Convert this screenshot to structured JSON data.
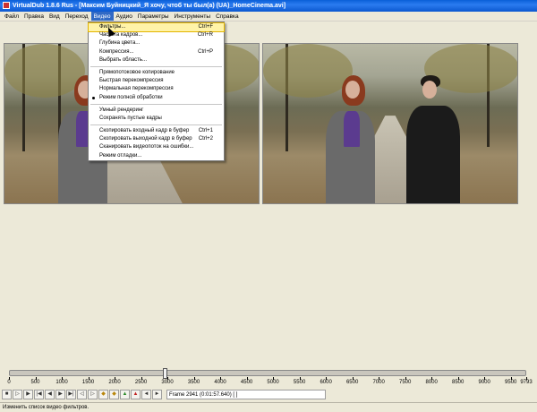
{
  "window": {
    "title": "VirtualDub 1.8.6 Rus - [Максим Буйницкий_Я хочу, чтоб ты был(а) (UA)_HomeCinema.avi]"
  },
  "menubar": {
    "items": [
      "Файл",
      "Правка",
      "Вид",
      "Переход",
      "Видео",
      "Аудио",
      "Параметры",
      "Инструменты",
      "Справка"
    ],
    "active": "Видео"
  },
  "video_menu": {
    "filters": {
      "label": "Фильтры...",
      "shortcut": "Ctrl+F"
    },
    "frame_rate": {
      "label": "Частота кадров...",
      "shortcut": "Ctrl+R"
    },
    "color_depth": {
      "label": "Глубина цвета..."
    },
    "compression": {
      "label": "Компрессия...",
      "shortcut": "Ctrl+P"
    },
    "select_range": {
      "label": "Выбрать область..."
    },
    "direct_copy": {
      "label": "Прямопотоковое копирование"
    },
    "fast_recompress": {
      "label": "Быстрая перекомпрессия"
    },
    "normal_recompress": {
      "label": "Нормальная перекомпрессия"
    },
    "full_processing": {
      "label": "Режим полной обработки",
      "checked": true
    },
    "smart_render": {
      "label": "Умный рендеринг"
    },
    "preserve_empty": {
      "label": "Сохранять пустые кадры"
    },
    "copy_source": {
      "label": "Скопировать входный кадр в буфер",
      "shortcut": "Ctrl+1"
    },
    "copy_output": {
      "label": "Скопировать выходной кадр в буфер",
      "shortcut": "Ctrl+2"
    },
    "scan_errors": {
      "label": "Сканировать видеопоток на ошибки..."
    },
    "error_mode": {
      "label": "Режим отладки..."
    }
  },
  "timeline": {
    "min": 0,
    "max": 9793,
    "current_frame": 2941,
    "tick_labels": [
      "0",
      "500",
      "1000",
      "1500",
      "2000",
      "2500",
      "3000",
      "3500",
      "4000",
      "4500",
      "5000",
      "5500",
      "6000",
      "6500",
      "7000",
      "7500",
      "8000",
      "8500",
      "9000",
      "9500",
      "9793"
    ]
  },
  "frame_info": "Frame 2941 (0:01:57.640) [ ]",
  "status": "Изменить список видео фильтров.",
  "icons": [
    "stop-icon",
    "play-input-icon",
    "play-output-icon",
    "go-start-icon",
    "prev-frame-icon",
    "next-frame-icon",
    "go-end-icon",
    "prev-key-icon",
    "next-key-icon",
    "scene-rewind-icon",
    "scene-forward-icon",
    "mark-in-icon",
    "mark-out-icon"
  ]
}
